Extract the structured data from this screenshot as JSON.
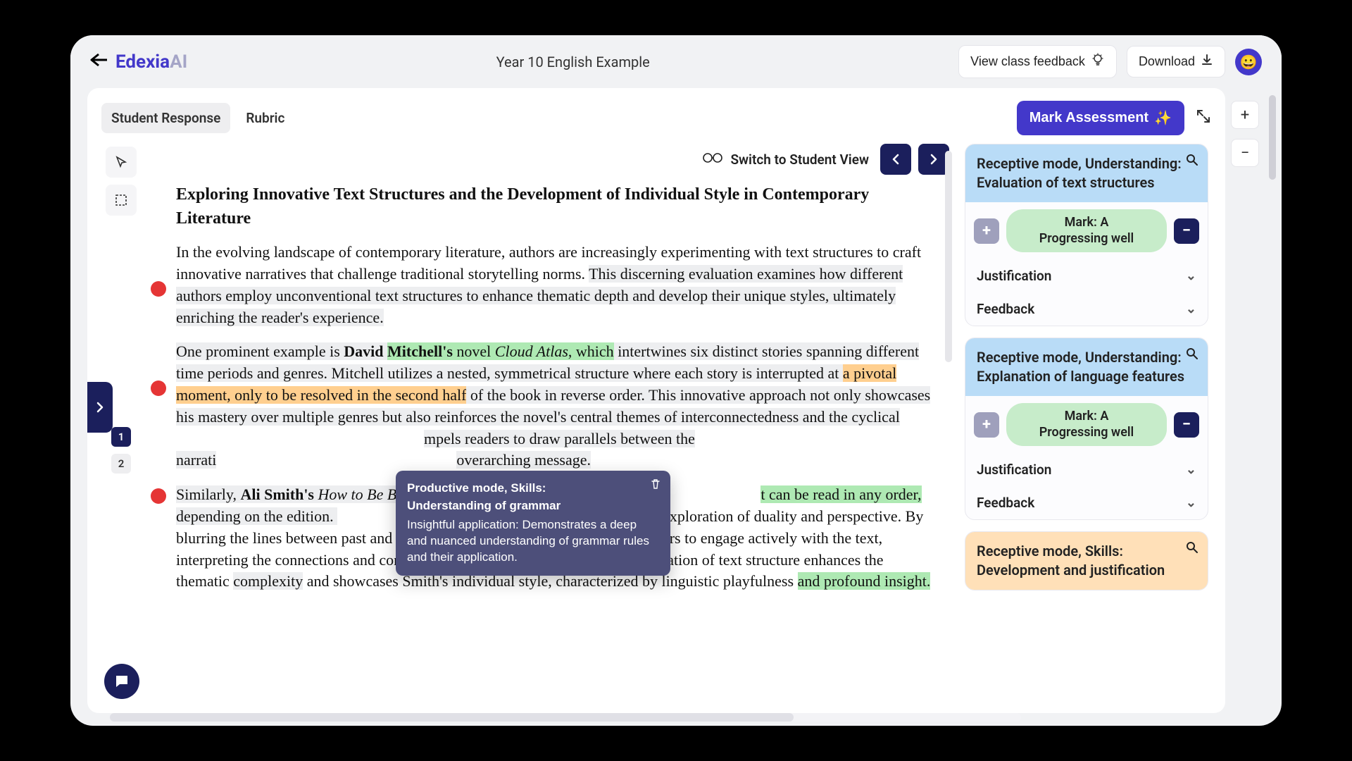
{
  "header": {
    "logo_main": "Edexia",
    "logo_ai": "AI",
    "title": "Year 10 English Example",
    "view_class_feedback": "View class feedback",
    "download": "Download",
    "avatar_emoji": "😀"
  },
  "tabs": {
    "student_response": "Student Response",
    "rubric": "Rubric"
  },
  "actions": {
    "mark_assessment": "Mark Assessment",
    "switch_student_view": "Switch to Student View"
  },
  "pages": {
    "p1": "1",
    "p2": "2"
  },
  "essay": {
    "title": "Exploring Innovative Text Structures and the Development of Individual Style in Contemporary Literature",
    "p1_a": "In the evolving landscape of contemporary literature, authors are increasingly experimenting with text structures to craft innovative narratives that challenge traditional storytelling norms. ",
    "p1_b": "This discerning evaluation examines how different authors employ unconventional text structures to enhance thematic depth and develop their unique styles, ultimately enriching the reader's experience.",
    "p2_a": "One prominent example is ",
    "p2_b": "David ",
    "p2_c": "Mitchell's",
    "p2_d": " novel ",
    "p2_e": "Cloud Atlas",
    "p2_f": ", which",
    "p2_g": " intertwines six distinct stories spanning different time periods and genres. Mitchell utilizes a nested, symmetrical structure where each story is interrupted at ",
    "p2_h": "a pivotal moment, only to be resolved in the second half",
    "p2_i": " of the book in reverse order.",
    "p2_j": " This innovative approach not only showcases his mastery over multiple genres but also reinforces the novel's central themes of interconnectedness and the cyclical ",
    "p2_k": "mpels readers to draw parallels between the narrati",
    "p2_l": "overarching message.",
    "p3_a": "Similarly, ",
    "p3_b": "Ali Smith's ",
    "p3_c": "How to Be Bo",
    "p3_d": "t can be read in any order,",
    "p3_e": " depending on the edition. ",
    "p3_f": "exploration of duality and perspective. By blurring the lines between past and present, and life and art, Smith invites readers to engage actively with the text, interpreting the connections and contrasts between the narratives. This manipulation of text structure enhances the thematic ",
    "p3_g": "complexity",
    "p3_h": " and showcases Smith's individual style, characterized by linguistic playfulness ",
    "p3_i": "and profound insight."
  },
  "tooltip": {
    "title": "Productive mode, Skills:",
    "subtitle": "Understanding of grammar",
    "body": "Insightful application: Demonstrates a deep and nuanced understanding of grammar rules and their application."
  },
  "feedback": {
    "card1_title": "Receptive mode, Understanding: Evaluation of text structures",
    "card2_title": "Receptive mode, Understanding: Explanation of language features",
    "card3_title": "Receptive mode, Skills: Development and justification",
    "mark_line1": "Mark: A",
    "mark_line2": "Progressing well",
    "justification": "Justification",
    "feedback_label": "Feedback"
  }
}
